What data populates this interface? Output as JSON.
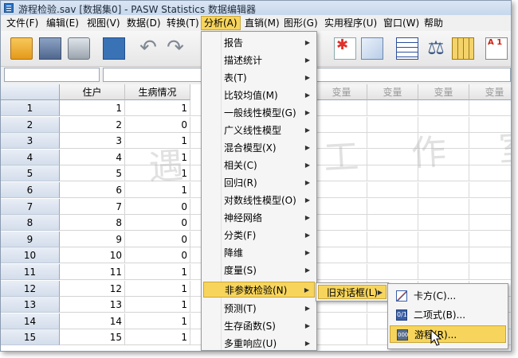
{
  "window": {
    "title": "游程检验.sav [数据集0] - PASW Statistics 数据编辑器"
  },
  "menubar": {
    "items": [
      {
        "label": "文件(F)"
      },
      {
        "label": "编辑(E)"
      },
      {
        "label": "视图(V)"
      },
      {
        "label": "数据(D)"
      },
      {
        "label": "转换(T)"
      },
      {
        "label": "分析(A)",
        "active": true
      },
      {
        "label": "直销(M)"
      },
      {
        "label": "图形(G)"
      },
      {
        "label": "实用程序(U)"
      },
      {
        "label": "窗口(W)"
      },
      {
        "label": "帮助"
      }
    ]
  },
  "toolbar": {
    "icons": [
      "open-folder-icon",
      "save-icon",
      "print-icon",
      "recall-dialog-icon",
      "undo-icon",
      "redo-icon",
      "grid-icon",
      "star-icon",
      "chart-icon",
      "table-icon",
      "balance-scale-icon",
      "columns-icon",
      "value-labels-icon"
    ],
    "value_labels_text": "A 1"
  },
  "grid": {
    "columns": [
      "住户",
      "生病情况"
    ],
    "empty_column_label": "变量",
    "rows": [
      {
        "row": "1",
        "zhuhu": "1",
        "shengbing": "1"
      },
      {
        "row": "2",
        "zhuhu": "2",
        "shengbing": "0"
      },
      {
        "row": "3",
        "zhuhu": "3",
        "shengbing": "1"
      },
      {
        "row": "4",
        "zhuhu": "4",
        "shengbing": "1"
      },
      {
        "row": "5",
        "zhuhu": "5",
        "shengbing": "1"
      },
      {
        "row": "6",
        "zhuhu": "6",
        "shengbing": "1"
      },
      {
        "row": "7",
        "zhuhu": "7",
        "shengbing": "0"
      },
      {
        "row": "8",
        "zhuhu": "8",
        "shengbing": "0"
      },
      {
        "row": "9",
        "zhuhu": "9",
        "shengbing": "0"
      },
      {
        "row": "10",
        "zhuhu": "10",
        "shengbing": "0"
      },
      {
        "row": "11",
        "zhuhu": "11",
        "shengbing": "1"
      },
      {
        "row": "12",
        "zhuhu": "12",
        "shengbing": "1"
      },
      {
        "row": "13",
        "zhuhu": "13",
        "shengbing": "1"
      },
      {
        "row": "14",
        "zhuhu": "14",
        "shengbing": "1"
      },
      {
        "row": "15",
        "zhuhu": "15",
        "shengbing": "1"
      }
    ]
  },
  "analyze_menu": {
    "items": [
      {
        "label": "报告",
        "submenu": true
      },
      {
        "label": "描述统计",
        "submenu": true
      },
      {
        "label": "表(T)",
        "submenu": true
      },
      {
        "label": "比较均值(M)",
        "submenu": true
      },
      {
        "label": "一般线性模型(G)",
        "submenu": true
      },
      {
        "label": "广义线性模型",
        "submenu": true
      },
      {
        "label": "混合模型(X)",
        "submenu": true
      },
      {
        "label": "相关(C)",
        "submenu": true
      },
      {
        "label": "回归(R)",
        "submenu": true
      },
      {
        "label": "对数线性模型(O)",
        "submenu": true
      },
      {
        "label": "神经网络",
        "submenu": true
      },
      {
        "label": "分类(F)",
        "submenu": true
      },
      {
        "label": "降维",
        "submenu": true
      },
      {
        "label": "度量(S)",
        "submenu": true
      },
      {
        "label": "非参数检验(N)",
        "submenu": true,
        "highlighted": true
      },
      {
        "label": "预测(T)",
        "submenu": true
      },
      {
        "label": "生存函数(S)",
        "submenu": true
      },
      {
        "label": "多重响应(U)",
        "submenu": true
      }
    ]
  },
  "legacy_submenu": {
    "label": "旧对话框(L)"
  },
  "legacy_items": [
    {
      "label": "卡方(C)...",
      "icon": "chi-square-icon"
    },
    {
      "label": "二项式(B)...",
      "icon": "binomial-icon"
    },
    {
      "label": "游程(R)...",
      "icon": "runs-icon",
      "highlighted": true
    }
  ],
  "watermark": "遇 人 工 作 室"
}
